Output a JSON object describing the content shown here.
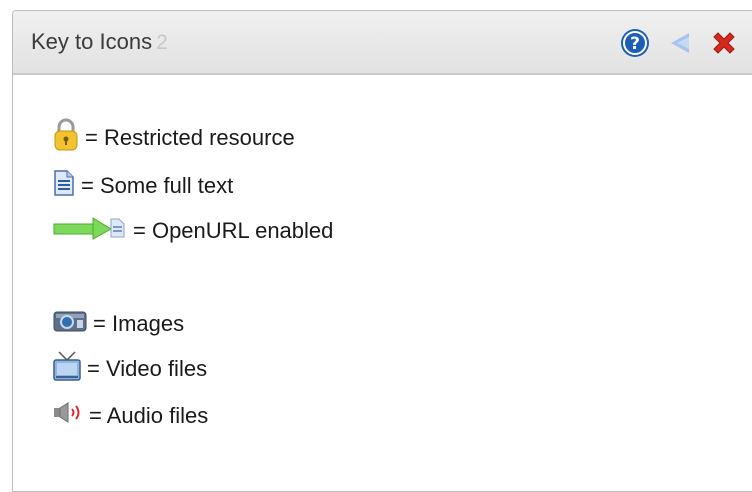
{
  "panel": {
    "title": "Key to Icons",
    "count": "2"
  },
  "header_icons": [
    "help-icon",
    "collapse-icon",
    "close-icon"
  ],
  "legend": {
    "restricted": {
      "icon": "padlock-icon",
      "text": "= Restricted resource"
    },
    "fulltext": {
      "icon": "document-icon",
      "text": "= Some full text"
    },
    "openurl": {
      "icon": "openurl-arrow-icon",
      "text": "= OpenURL enabled"
    },
    "images": {
      "icon": "camera-icon",
      "text": "= Images"
    },
    "video": {
      "icon": "tv-icon",
      "text": "= Video files"
    },
    "audio": {
      "icon": "speaker-icon",
      "text": "= Audio files"
    }
  },
  "colors": {
    "header_bg": "#e6e6e6",
    "help_blue": "#1d5fb3",
    "close_red": "#d42a1e",
    "arrow_green": "#7dd95a"
  }
}
